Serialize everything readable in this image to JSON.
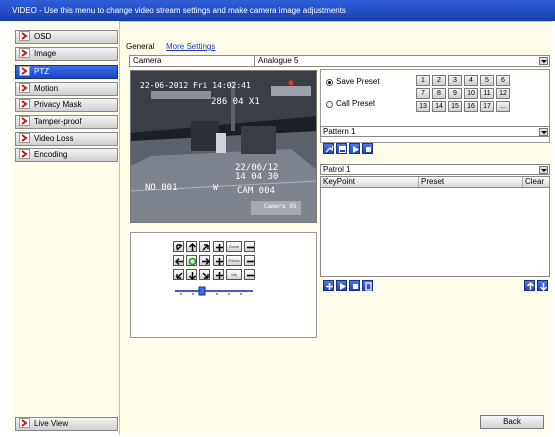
{
  "title": "VIDEO - Use this menu to change video stream settings and make camera image adjustments",
  "sidebar": {
    "items": [
      {
        "label": "OSD",
        "active": false
      },
      {
        "label": "Image",
        "active": false
      },
      {
        "label": "PTZ",
        "active": true
      },
      {
        "label": "Motion",
        "active": false
      },
      {
        "label": "Privacy Mask",
        "active": false
      },
      {
        "label": "Tamper-proof",
        "active": false
      },
      {
        "label": "Video Loss",
        "active": false
      },
      {
        "label": "Encoding",
        "active": false
      }
    ],
    "live_view": "Live View"
  },
  "tabs": {
    "general": "General",
    "more": "More Settings"
  },
  "camera": {
    "label": "Camera",
    "value": "Analogue 5"
  },
  "video": {
    "datetime": "22-06-2012 Fri 14:02:41",
    "zoom": "286  04 X1",
    "ov_date": "22/06/12",
    "ov_time": "14 04 30",
    "no": "NO 001",
    "w": "W",
    "cam": "CAM 004",
    "camera05": "Camera 05"
  },
  "ptz_controls": {
    "zoom": "Zoom",
    "focus": "Focus",
    "iris": "Iris"
  },
  "preset": {
    "save": "Save Preset",
    "call": "Call Preset",
    "mode": "save",
    "buttons": [
      "1",
      "2",
      "3",
      "4",
      "5",
      "6",
      "7",
      "8",
      "9",
      "10",
      "11",
      "12",
      "13",
      "14",
      "15",
      "16",
      "17",
      "..."
    ]
  },
  "pattern": {
    "label": "Pattern 1"
  },
  "patrol": {
    "label": "Patrol 1",
    "columns": [
      "KeyPoint",
      "Preset",
      "Clear"
    ]
  },
  "back": "Back",
  "colors": {
    "accent": "#1d46c4",
    "panel": "#fffde9",
    "link": "#1b36c9"
  }
}
